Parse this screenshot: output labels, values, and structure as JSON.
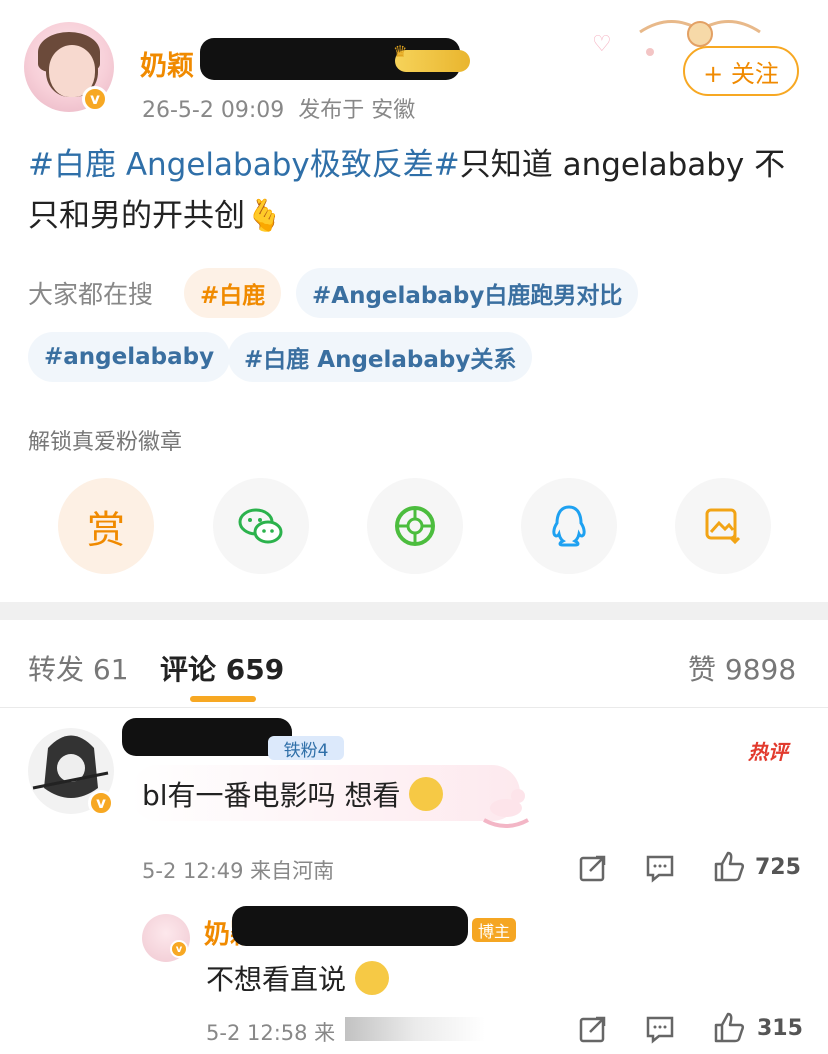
{
  "post": {
    "author_name_visible": "奶颖",
    "verified_mark": "v",
    "timestamp": "26-5-2 09:09",
    "location": "发布于 安徽",
    "follow_label": "+ 关注",
    "text_tag": "#白鹿 Angelababy极致反差#",
    "text_body": "只知道 angelababy 不只和男的开共创",
    "text_emoji": "🫰"
  },
  "search": {
    "label": "大家都在搜",
    "chips": [
      "#白鹿",
      "#Angelababy白鹿跑男对比",
      "#angelababy",
      "#白鹿 Angelababy关系"
    ]
  },
  "unlock_label": "解锁真爱粉徽章",
  "share": {
    "reward_label": "赏",
    "icons": [
      "reward-icon",
      "wechat-icon",
      "moments-icon",
      "qq-icon",
      "save-image-icon"
    ]
  },
  "tabs": {
    "repost": "转发 61",
    "comments": "评论 659",
    "likes": "赞 9898"
  },
  "comments": [
    {
      "fan_badge": "铁粉4",
      "hot_label": "热评",
      "text": "bl有一番电影吗 想看",
      "meta": "5-2 12:49  来自河南",
      "likes": "725"
    },
    {
      "author_name_visible": "奶颖",
      "role_badge": "博主",
      "text": "不想看直说",
      "meta": "5-2 12:58  来",
      "likes": "315"
    }
  ],
  "colors": {
    "accent": "#f08a00",
    "tag_blue": "#2f6fa8",
    "hot_red": "#e23b2e"
  }
}
